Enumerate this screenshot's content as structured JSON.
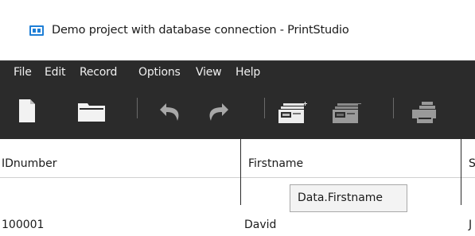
{
  "window": {
    "title": "Demo project with database connection - PrintStudio",
    "icon": "app-icon"
  },
  "menu": {
    "items": [
      "File",
      "Edit",
      "Record",
      "Options",
      "View",
      "Help"
    ]
  },
  "toolbar": {
    "buttons": [
      "new-document-icon",
      "open-folder-icon",
      "undo-icon",
      "redo-icon",
      "add-record-icon",
      "delete-record-icon",
      "print-icon"
    ]
  },
  "grid": {
    "columns": [
      "IDnumber",
      "Firstname",
      "S"
    ],
    "tooltip": "Data.Firstname",
    "rows": [
      [
        "100001",
        "David",
        "J"
      ]
    ]
  }
}
